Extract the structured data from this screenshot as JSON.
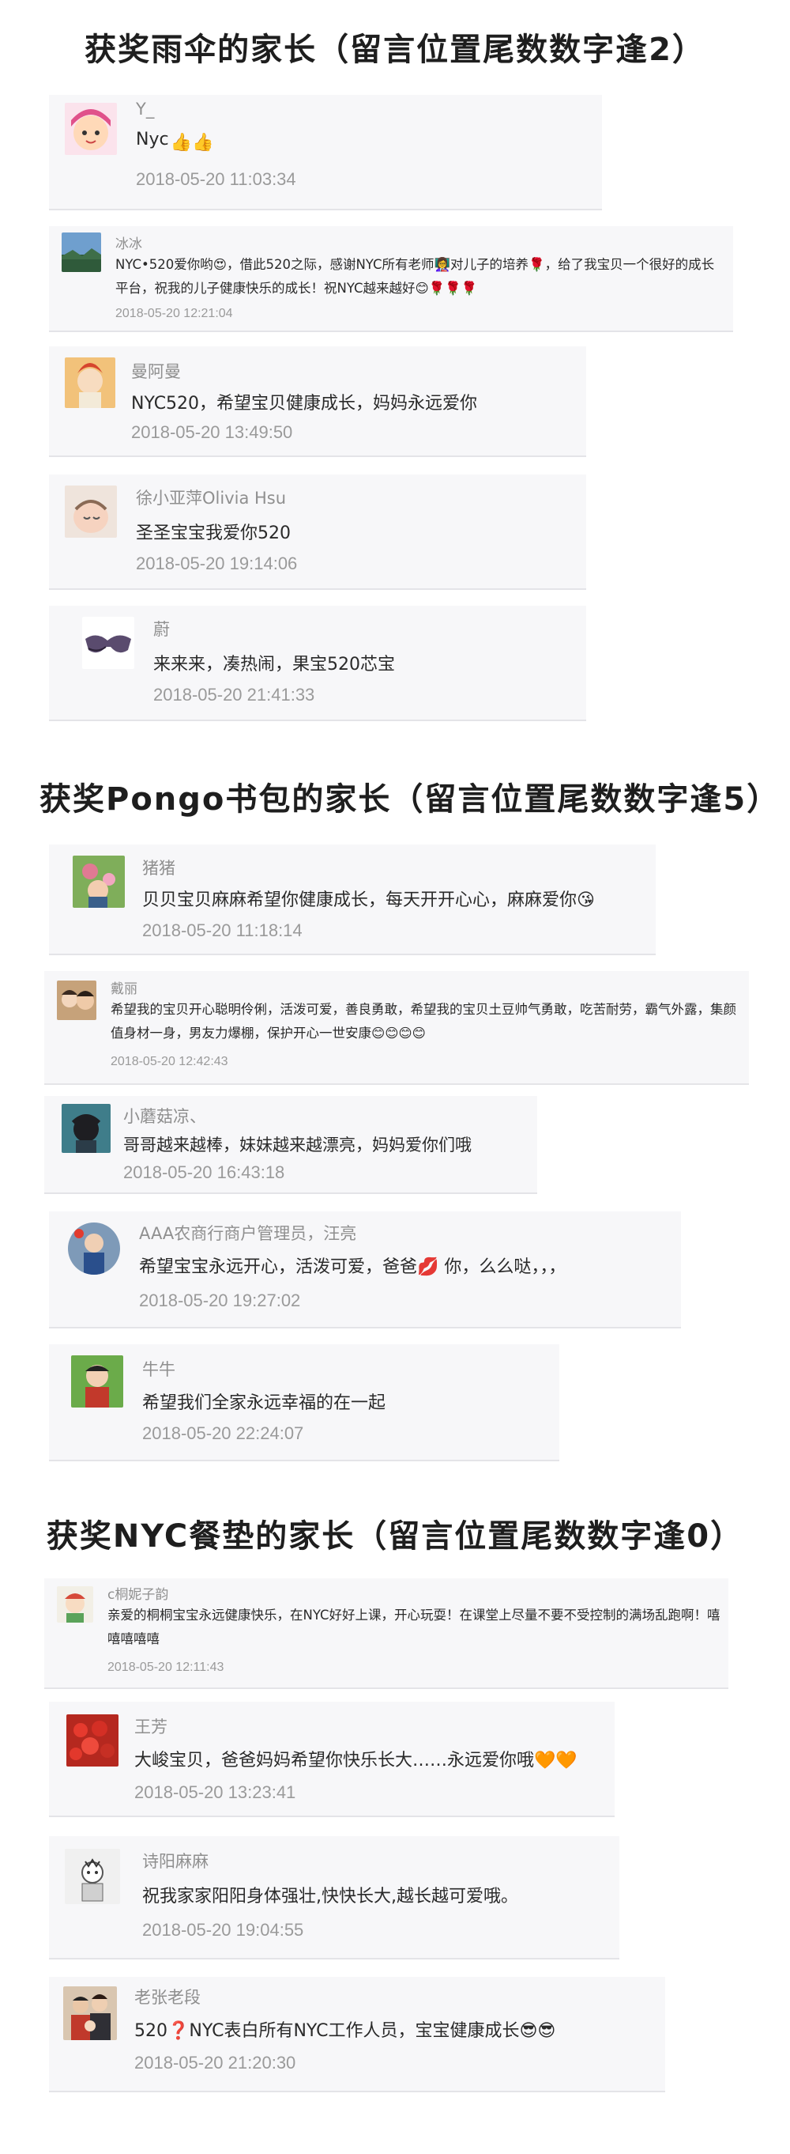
{
  "sections": [
    {
      "heading": "获奖雨伞的家长（留言位置尾数数字逢2）",
      "comments": [
        {
          "name": "Y_",
          "message": "Nyc",
          "time": "2018-05-20 11:03:34"
        },
        {
          "name": "冰冰",
          "message": "NYC•520爱你哟😍，借此520之际，感谢NYC所有老师👩‍🏫对儿子的培养🌹，给了我宝贝一个很好的成长平台，祝我的儿子健康快乐的成长！祝NYC越来越好😊🌹🌹🌹",
          "time": "2018-05-20 12:21:04"
        },
        {
          "name": "曼阿曼",
          "message": "NYC520，希望宝贝健康成长，妈妈永远爱你",
          "time": "2018-05-20 13:49:50"
        },
        {
          "name": "徐小亚萍Olivia Hsu",
          "message": "圣圣宝宝我爱你520",
          "time": "2018-05-20 19:14:06"
        },
        {
          "name": "蔚",
          "message": "来来来，凑热闹，果宝520芯宝",
          "time": "2018-05-20 21:41:33"
        }
      ]
    },
    {
      "heading": "获奖Pongo书包的家长（留言位置尾数数字逢5）",
      "comments": [
        {
          "name": "猪猪",
          "message": "贝贝宝贝麻麻希望你健康成长，每天开开心心，麻麻爱你😘",
          "time": "2018-05-20 11:18:14"
        },
        {
          "name": "戴丽",
          "message": "希望我的宝贝开心聪明伶俐，活泼可爱，善良勇敢，希望我的宝贝土豆帅气勇敢，吃苦耐劳，霸气外露，集颜值身材一身，男友力爆棚，保护开心一世安康😊😊😊😊",
          "time": "2018-05-20 12:42:43"
        },
        {
          "name": "小蘑菇凉、",
          "message": "哥哥越来越棒，妹妹越来越漂亮，妈妈爱你们哦",
          "time": "2018-05-20 16:43:18"
        },
        {
          "name": "AAA农商行商户管理员，汪亮",
          "message": "希望宝宝永远开心，活泼可爱，爸爸💋 你，么么哒，，，",
          "time": "2018-05-20 19:27:02"
        },
        {
          "name": "牛牛",
          "message": "希望我们全家永远幸福的在一起",
          "time": "2018-05-20 22:24:07"
        }
      ]
    },
    {
      "heading": "获奖NYC餐垫的家长（留言位置尾数数字逢0）",
      "comments": [
        {
          "name": "c桐妮子韵",
          "message": "亲爱的桐桐宝宝永远健康快乐，在NYC好好上课，开心玩耍！在课堂上尽量不要不受控制的满场乱跑啊！嘻嘻嘻嘻嘻",
          "time": "2018-05-20 12:11:43"
        },
        {
          "name": "王芳",
          "message": "大峻宝贝，爸爸妈妈希望你快乐长大……永远爱你哦🧡🧡",
          "time": "2018-05-20 13:23:41"
        },
        {
          "name": "诗阳麻麻",
          "message": "祝我家家阳阳身体强壮,快快长大,越长越可爱哦。",
          "time": "2018-05-20 19:04:55"
        },
        {
          "name": "老张老段",
          "message": "520❓NYC表白所有NYC工作人员，宝宝健康成长😎😎",
          "time": "2018-05-20 21:20:30"
        }
      ]
    }
  ],
  "emoji": {
    "thumbs": "👍👍"
  },
  "colors": {
    "card_bg": "#f7f7f9",
    "name": "#8f8f8f",
    "time": "#9a9a9a",
    "text": "#2a2a2a"
  }
}
